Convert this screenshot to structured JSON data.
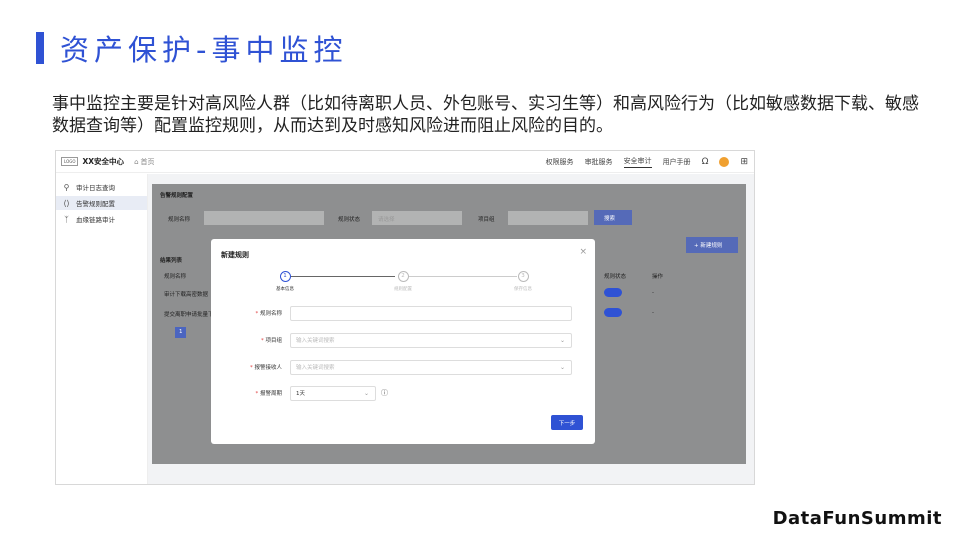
{
  "slide": {
    "title": "资产保护-事中监控",
    "description": "事中监控主要是针对高风险人群（比如待离职人员、外包账号、实习生等）和高风险行为（比如敏感数据下载、敏感数据查询等）配置监控规则，从而达到及时感知风险进而阻止风险的目的。",
    "brand": "DataFunSummit",
    "accent_color": "#2f52d4"
  },
  "app": {
    "logo": "LOGO",
    "name": "XX安全中心",
    "home": "首页",
    "nav": [
      "权限服务",
      "审批服务",
      "安全审计",
      "用户手册"
    ],
    "active_nav": "安全审计",
    "icons": [
      "headset-icon",
      "user-avatar-icon",
      "grid-apps-icon"
    ]
  },
  "sidebar": {
    "items": [
      {
        "label": "审计日志查询",
        "icon": "search-icon"
      },
      {
        "label": "告警规则配置",
        "icon": "code-icon"
      },
      {
        "label": "血缘链路审计",
        "icon": "branch-icon"
      }
    ]
  },
  "background": {
    "section1_title": "告警规则配置",
    "rule_name_label": "规则名称",
    "rule_status_label": "规则状态",
    "status_placeholder": "请选择",
    "project_label": "项目组",
    "search_button": "搜索",
    "section2_title": "结果列表",
    "new_rule_button": "+ 新建规则",
    "col_rule_name": "规则名称",
    "col_rule_status": "规则状态",
    "col_ops": "操作",
    "row1": "审计下载高密数据",
    "row2": "提交离职申请批量下",
    "row_op": "-",
    "page": "1"
  },
  "modal": {
    "title": "新建规则",
    "close": "×",
    "steps": [
      {
        "num": "1",
        "label": "基本信息"
      },
      {
        "num": "2",
        "label": "规则配置"
      },
      {
        "num": "3",
        "label": "保存信息"
      }
    ],
    "fields": {
      "rule_name_label": "规则名称",
      "rule_name_value": "",
      "project_label": "项目组",
      "project_placeholder": "输入关键词搜索",
      "receiver_label": "报警接收人",
      "receiver_placeholder": "输入关键词搜索",
      "period_label": "报警周期",
      "period_value": "1天"
    },
    "required_mark": "*",
    "next_button": "下一步"
  }
}
